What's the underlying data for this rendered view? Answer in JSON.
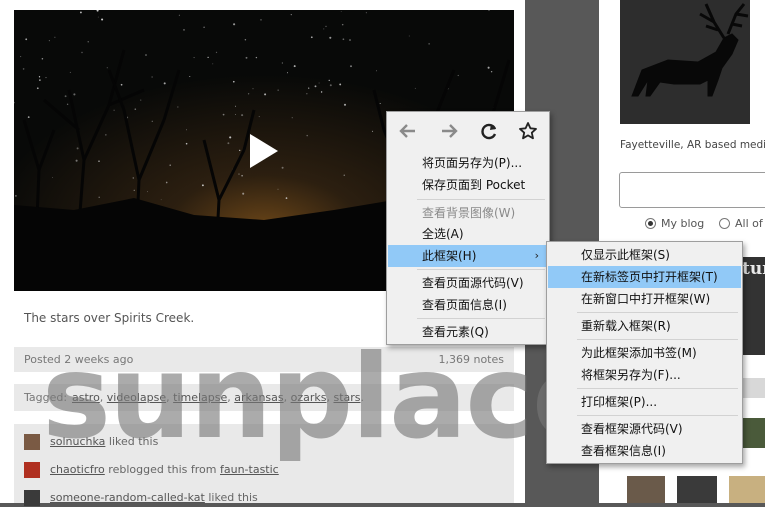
{
  "post": {
    "caption": "The stars over Spirits Creek.",
    "posted": "Posted 2 weeks ago",
    "notes_count": "1,369 notes",
    "tags_label": "Tagged:",
    "tags": [
      "astro",
      "videolapse",
      "timelapse",
      "arkansas",
      "ozarks",
      "stars"
    ],
    "tag_separator": ", ",
    "tags_end": "."
  },
  "notes": [
    {
      "user": "solnuchka",
      "action": " liked this",
      "avatar_color": "#7a5a44"
    },
    {
      "user": "chaoticfro",
      "action": " reblogged this from ",
      "source": "faun-tastic",
      "avatar_color": "#b03020"
    },
    {
      "user": "someone-random-called-kat",
      "action": " liked this",
      "avatar_color": "#3a3a3a"
    }
  ],
  "sidebar": {
    "bio": "Fayetteville, AR based medi",
    "radio_myblog": "My blog",
    "radio_all": "All of",
    "heading_fragment": "tur"
  },
  "watermark": "sunplace",
  "context_menu": {
    "nav": [
      "back-arrow-icon",
      "forward-arrow-icon",
      "reload-icon",
      "bookmark-star-icon"
    ],
    "items": [
      {
        "label": "将页面另存为(P)..."
      },
      {
        "label": "保存页面到 Pocket"
      },
      {
        "label": "查看背景图像(W)"
      },
      {
        "label": "全选(A)"
      },
      {
        "label": "此框架(H)"
      },
      {
        "label": "查看页面源代码(V)"
      },
      {
        "label": "查看页面信息(I)"
      },
      {
        "label": "查看元素(Q)"
      }
    ],
    "submenu_arrow": "›"
  },
  "frame_submenu": {
    "items": [
      {
        "label": "仅显示此框架(S)"
      },
      {
        "label": "在新标签页中打开框架(T)"
      },
      {
        "label": "在新窗口中打开框架(W)"
      },
      {
        "label": "重新载入框架(R)"
      },
      {
        "label": "为此框架添加书签(M)"
      },
      {
        "label": "将框架另存为(F)..."
      },
      {
        "label": "打印框架(P)..."
      },
      {
        "label": "查看框架源代码(V)"
      },
      {
        "label": "查看框架信息(I)"
      }
    ]
  },
  "colors": {
    "highlight": "#91c9f7",
    "menu_bg": "#f0f0f0",
    "page_bg": "#585858",
    "disabled_text": "#8a8a8a"
  }
}
